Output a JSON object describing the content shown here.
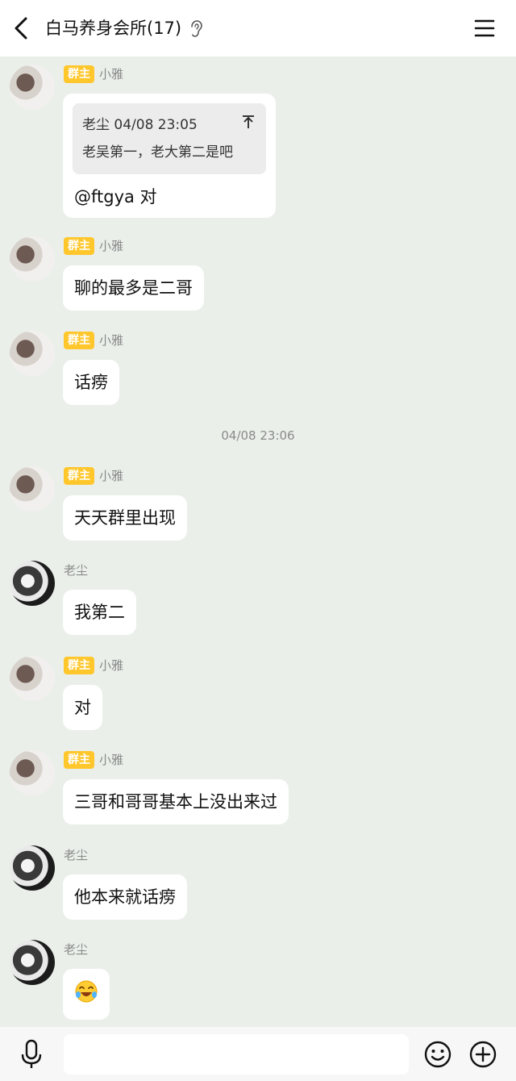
{
  "header": {
    "title": "白马养身会所(17)",
    "back_icon": "chevron-left-icon",
    "mode_icon": "ear-icon",
    "menu_icon": "hamburger-menu-icon"
  },
  "badge_label": "群主",
  "messages": [
    {
      "sender": "小雅",
      "badge": "群主",
      "quote": {
        "header": "老尘 04/08 23:05",
        "text": "老吴第一，老大第二是吧"
      },
      "text": "@ftgya 对"
    },
    {
      "sender": "小雅",
      "badge": "群主",
      "text": "聊的最多是二哥"
    },
    {
      "sender": "小雅",
      "badge": "群主",
      "text": "话痨"
    },
    {
      "sender": "小雅",
      "badge": "群主",
      "text": "天天群里出现"
    },
    {
      "sender": "老尘",
      "text": "我第二"
    },
    {
      "sender": "小雅",
      "badge": "群主",
      "text": "对"
    },
    {
      "sender": "小雅",
      "badge": "群主",
      "text": "三哥和哥哥基本上没出来过"
    },
    {
      "sender": "老尘",
      "text": "他本来就话痨"
    },
    {
      "sender": "老尘",
      "emoji": "laughing-crying-emoji"
    }
  ],
  "timestamp_separator": "04/08 23:06",
  "input_bar": {
    "voice_icon": "microphone-icon",
    "text_value": "",
    "emoji_icon": "smiley-icon",
    "more_icon": "plus-circle-icon"
  },
  "colors": {
    "background": "#eaefea",
    "bubble": "#ffffff",
    "badge": "#ffc72c",
    "quote_bg": "#ececec"
  }
}
